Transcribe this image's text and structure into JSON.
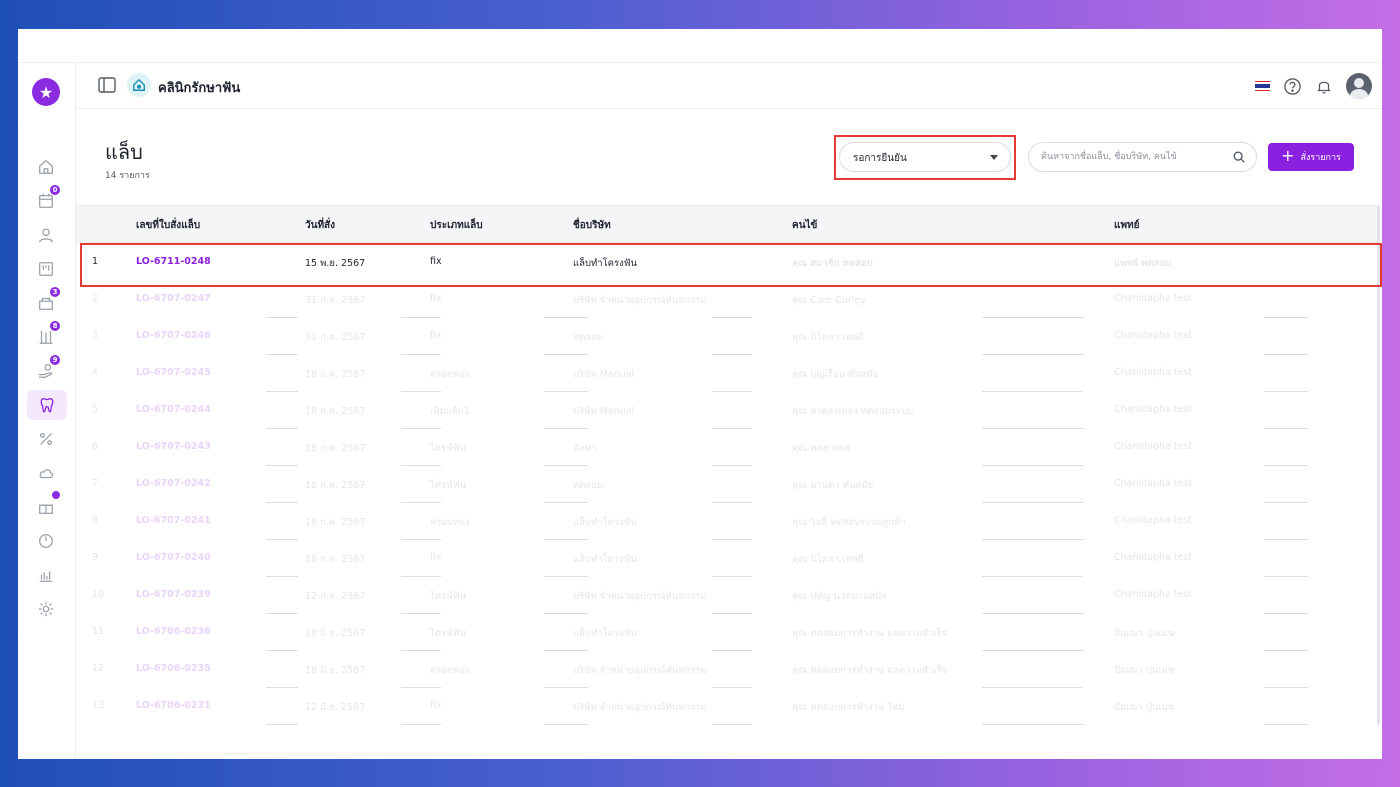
{
  "app": {
    "clinic_name": "คลินิกรักษาฟัน"
  },
  "sidebar": {
    "badges": {
      "appointments": "0",
      "inventory": "3",
      "lab_tools": "8",
      "payments": "9"
    }
  },
  "page": {
    "title": "แล็บ",
    "count": "14 รายการ"
  },
  "filter": {
    "status_value": "รอการยืนยัน"
  },
  "search": {
    "placeholder": "ค้นหาจากชื่อแล็บ, ชื่อบริษัท, คนไข้"
  },
  "actions": {
    "add_label": "สั่งรายการ"
  },
  "table": {
    "headers": {
      "order_no": "เลขที่ใบสั่งแล็บ",
      "date": "วันที่สั่ง",
      "lab_type": "ประเภทแล็บ",
      "company": "ชื่อบริษัท",
      "patient": "คนไข้",
      "doctor": "แพทย์"
    },
    "rows": [
      {
        "no": "1",
        "code": "LO-6711-0248",
        "date": "15 พ.ย. 2567",
        "type": "fix",
        "company": "แล็บทำโครงฟัน",
        "patient": "คุณ สมาชิก ทดสอบ",
        "doctor": "แพทย์ ทดสอบ"
      },
      {
        "no": "2",
        "code": "LO-6707-0247",
        "date": "31 ก.ค. 2567",
        "type": "fix",
        "company": "บริษัท จำหน่ายอุปกรณ์ทันตกรรม",
        "patient": "คุณ Care Curley",
        "doctor": "Chanidapha test"
      },
      {
        "no": "3",
        "code": "LO-6707-0246",
        "date": "31 ก.ค. 2567",
        "type": "fix",
        "company": "ทดสอบ",
        "patient": "คุณ นิโคลา เทสดี",
        "doctor": "Chanidapha test"
      },
      {
        "no": "4",
        "code": "LO-6707-0245",
        "date": "18 ก.ค. 2567",
        "type": "ครอบทอง",
        "company": "บริษัท Manual",
        "patient": "คุณ บุญเรือน ทันสมัย",
        "doctor": "Chanidapha test"
      },
      {
        "no": "5",
        "code": "LO-6707-0244",
        "date": "18 ก.ค. 2567",
        "type": "เพิ่มแล็บ1",
        "company": "บริษัท Manual",
        "patient": "คุณ ลาดลงเพลง ทดสอบระบบ",
        "doctor": "Chanidapha test"
      },
      {
        "no": "6",
        "code": "LO-6707-0243",
        "date": "18 ก.ค. 2567",
        "type": "ไดรฟ์ฟัน",
        "company": "อัลฟา",
        "patient": "คุณ ทดส ทดส",
        "doctor": "Chanidapha test"
      },
      {
        "no": "7",
        "code": "LO-6707-0242",
        "date": "18 ก.ค. 2567",
        "type": "ไดรฟ์ฟัน",
        "company": "ทดสอบ",
        "patient": "คุณ มานดา ทันสมัย",
        "doctor": "Chanidapha test"
      },
      {
        "no": "8",
        "code": "LO-6707-0241",
        "date": "18 ก.ค. 2567",
        "type": "ครอบทอง",
        "company": "แล็บทำโครงฟัน",
        "patient": "คุณ วิลลี่ ทดสอบระบบลูกค้า",
        "doctor": "Chanidapha test"
      },
      {
        "no": "9",
        "code": "LO-6707-0240",
        "date": "18 ก.ค. 2567",
        "type": "fix",
        "company": "แล็บทำโครงฟัน",
        "patient": "คุณ นิโคลา เทสดี",
        "doctor": "Chanidapha test"
      },
      {
        "no": "10",
        "code": "LO-6707-0239",
        "date": "12 ก.ค. 2567",
        "type": "ไดรฟ์ฟัน",
        "company": "บริษัท จำหน่ายอุปกรณ์ทันตกรรม",
        "patient": "คุณ ปทัญ นวลนามสมัย",
        "doctor": "Chanidapha test"
      },
      {
        "no": "11",
        "code": "LO-6706-0236",
        "date": "18 มิ.ย. 2567",
        "type": "ไดรฟ์ฟัน",
        "company": "แล็บทำโครงฟัน",
        "patient": "คุณ ทดสอบการทำงาน ผลความสำเร็จ",
        "doctor": "ปัณณา ปุ่นเมฆ"
      },
      {
        "no": "12",
        "code": "LO-6706-0235",
        "date": "18 มิ.ย. 2567",
        "type": "ครอบทอง",
        "company": "บริษัท จำหน่ายอุปกรณ์ทันตกรรม",
        "patient": "คุณ ทดสอบการทำงาน ผลความสำเร็จ",
        "doctor": "ปัณณา ปุ่นเมฆ"
      },
      {
        "no": "13",
        "code": "LO-6706-0231",
        "date": "12 มิ.ย. 2567",
        "type": "fix",
        "company": "บริษัท จำหน่ายอุปกรณ์ทันตกรรม",
        "patient": "คุณ ทดสอบการทำงาน ใหม่",
        "doctor": "ปัณณา ปุ่นเมฆ"
      }
    ]
  },
  "colors": {
    "accent": "#8a20e0",
    "highlight": "#e53935"
  }
}
